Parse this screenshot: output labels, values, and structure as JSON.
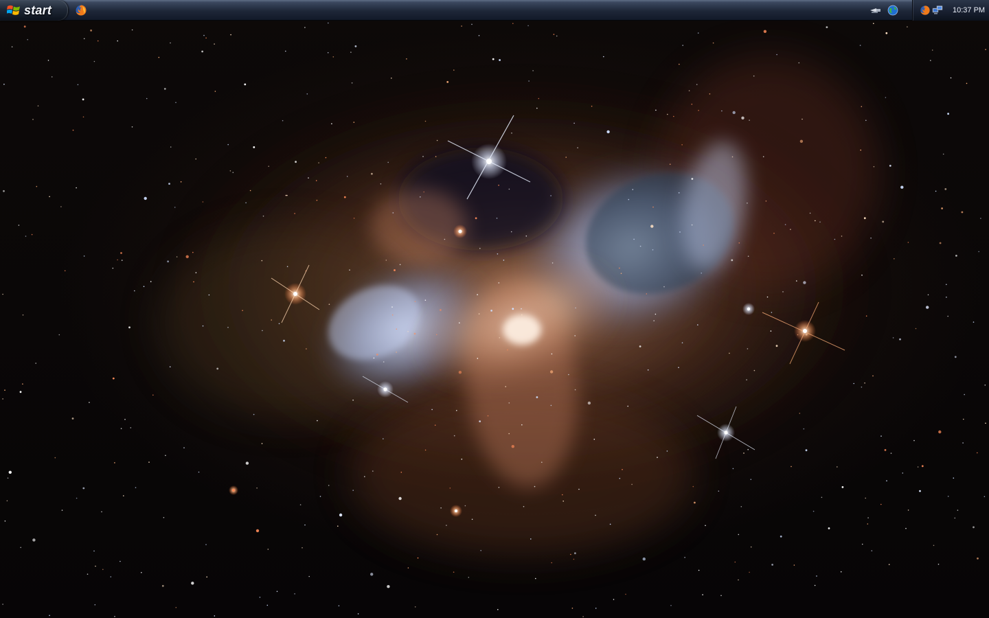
{
  "taskbar": {
    "start_label": "start",
    "clock": "10:37 PM"
  },
  "icons": {
    "start_flag": "windows-flag-icon",
    "quick_launch": "firefox-icon",
    "tray_left": [
      "usb-device-icon",
      "globe-network-icon"
    ],
    "tray_app": "firefox-icon",
    "tray_network": "network-computers-icon"
  },
  "colors": {
    "taskbar_top": "#5f6e86",
    "taskbar_bottom": "#121a29",
    "clock_text": "#e9eef7",
    "wallpaper_dark": "#0b0807",
    "nebula_blue": "#b9c8ee",
    "nebula_orange": "#d39e7f"
  }
}
